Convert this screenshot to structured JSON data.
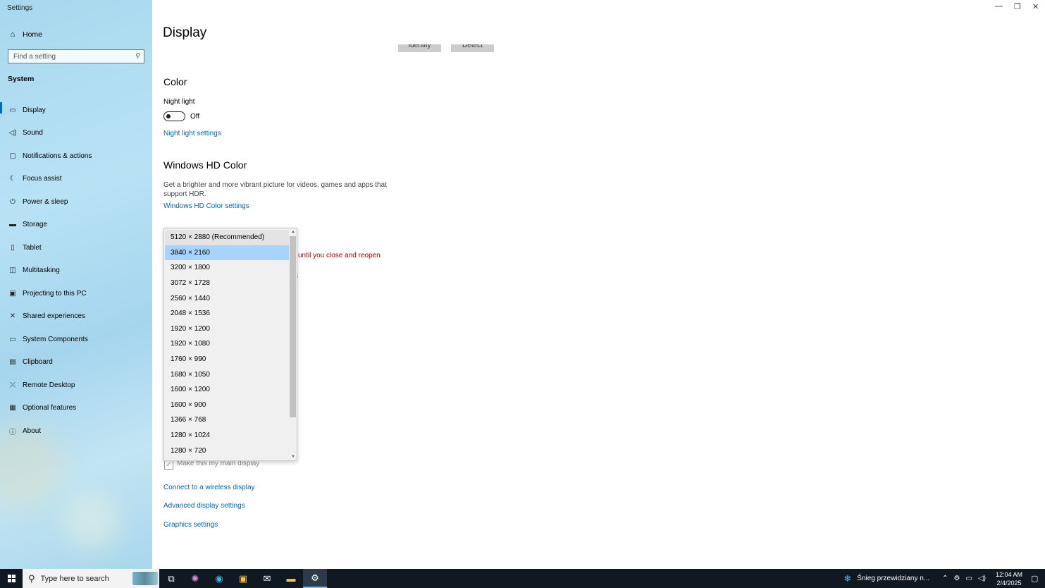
{
  "window": {
    "title": "Settings"
  },
  "sidebar": {
    "home_label": "Home",
    "search_placeholder": "Find a setting",
    "section": "System",
    "items": [
      {
        "label": "Display",
        "icon": "monitor-icon"
      },
      {
        "label": "Sound",
        "icon": "speaker-icon"
      },
      {
        "label": "Notifications & actions",
        "icon": "message-icon"
      },
      {
        "label": "Focus assist",
        "icon": "moon-icon"
      },
      {
        "label": "Power & sleep",
        "icon": "power-icon"
      },
      {
        "label": "Storage",
        "icon": "storage-icon"
      },
      {
        "label": "Tablet",
        "icon": "tablet-icon"
      },
      {
        "label": "Multitasking",
        "icon": "multitasking-icon"
      },
      {
        "label": "Projecting to this PC",
        "icon": "projector-icon"
      },
      {
        "label": "Shared experiences",
        "icon": "share-icon"
      },
      {
        "label": "System Components",
        "icon": "components-icon"
      },
      {
        "label": "Clipboard",
        "icon": "clipboard-icon"
      },
      {
        "label": "Remote Desktop",
        "icon": "remote-icon"
      },
      {
        "label": "Optional features",
        "icon": "features-icon"
      },
      {
        "label": "About",
        "icon": "info-icon"
      }
    ]
  },
  "main": {
    "page_title": "Display",
    "identify_label": "Identify",
    "detect_label": "Detect",
    "color_heading": "Color",
    "night_light_label": "Night light",
    "night_light_state": "Off",
    "night_light_link": "Night light settings",
    "hdr_heading": "Windows HD Color",
    "hdr_desc": "Get a brighter and more vibrant picture for videos, games and apps that support HDR.",
    "hdr_link": "Windows HD Color settings",
    "warning_fragment": "until you close and reopen",
    "partial_fragment": "s",
    "main_display_label": "Make this my main display",
    "wireless_link": "Connect to a wireless display",
    "advanced_link": "Advanced display settings",
    "graphics_link": "Graphics settings"
  },
  "resolution_dropdown": {
    "options": [
      "5120 × 2880 (Recommended)",
      "3840 × 2160",
      "3200 × 1800",
      "3072 × 1728",
      "2560 × 1440",
      "2048 × 1536",
      "1920 × 1200",
      "1920 × 1080",
      "1760 × 990",
      "1680 × 1050",
      "1600 × 1200",
      "1600 × 900",
      "1366 × 768",
      "1280 × 1024",
      "1280 × 720"
    ],
    "selected": "3840 × 2160"
  },
  "taskbar": {
    "search_placeholder": "Type here to search",
    "weather": "Śnieg przewidziany n...",
    "time": "12:04 AM",
    "date": "2/4/2025"
  },
  "colors": {
    "accent": "#0067c0",
    "link": "#0066b4",
    "warning": "#a80000",
    "selection": "#a6d4ff"
  }
}
